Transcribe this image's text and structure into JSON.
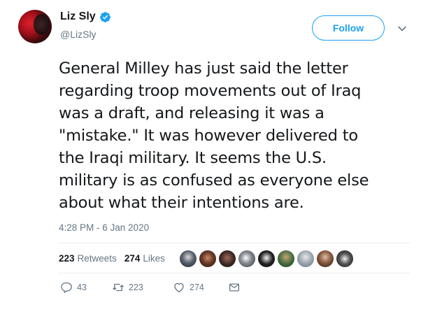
{
  "author": {
    "display_name": "Liz Sly",
    "handle": "@LizSly",
    "verified_icon": "verified-badge-icon"
  },
  "header": {
    "follow_label": "Follow",
    "menu_icon": "chevron-down-icon"
  },
  "tweet": {
    "lines": [
      "General Milley has just said the letter",
      "regarding troop movements out of Iraq",
      "was a draft, and releasing it was a",
      "\"mistake.\" It was however delivered to",
      "the Iraqi military. It seems the U.S.",
      "military is as confused as everyone else",
      "about what their intentions are."
    ],
    "timestamp": "4:28 PM - 6 Jan 2020"
  },
  "stats": {
    "retweets_count": "223",
    "retweets_label": "Retweets",
    "likes_count": "274",
    "likes_label": "Likes",
    "liker_avatar_count": 9
  },
  "actions": {
    "reply_count": "43",
    "retweet_count": "223",
    "like_count": "274"
  },
  "colors": {
    "accent": "#1da1f2",
    "secondary_text": "#657786",
    "primary_text": "#14171a",
    "divider": "#e6ecf0"
  }
}
